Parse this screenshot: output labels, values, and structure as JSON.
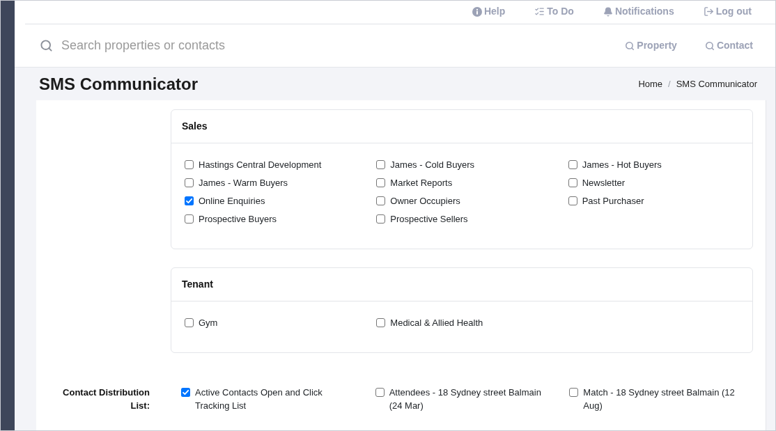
{
  "top_nav": [
    {
      "label": "Help"
    },
    {
      "label": "To Do"
    },
    {
      "label": "Notifications"
    },
    {
      "label": "Log out"
    }
  ],
  "search": {
    "placeholder": "Search properties or contacts"
  },
  "search_links": [
    {
      "label": "Property"
    },
    {
      "label": "Contact"
    }
  ],
  "page_header": {
    "title": "SMS Communicator",
    "breadcrumb": {
      "items": [
        {
          "label": "Home"
        },
        {
          "label": "SMS Communicator"
        }
      ],
      "separator": "/"
    }
  },
  "groups": [
    {
      "title": "Sales",
      "options": [
        {
          "label": "Hastings Central Development",
          "checked": false
        },
        {
          "label": "James - Cold Buyers",
          "checked": false
        },
        {
          "label": "James - Hot Buyers",
          "checked": false
        },
        {
          "label": "James - Warm Buyers",
          "checked": false
        },
        {
          "label": "Market Reports",
          "checked": false
        },
        {
          "label": "Newsletter",
          "checked": false
        },
        {
          "label": "Online Enquiries",
          "checked": true
        },
        {
          "label": "Owner Occupiers",
          "checked": false
        },
        {
          "label": "Past Purchaser",
          "checked": false
        },
        {
          "label": "Prospective Buyers",
          "checked": false
        },
        {
          "label": "Prospective Sellers",
          "checked": false
        }
      ]
    },
    {
      "title": "Tenant",
      "options": [
        {
          "label": "Gym",
          "checked": false
        },
        {
          "label": "Medical & Allied Health",
          "checked": false
        }
      ]
    }
  ],
  "distribution_list": {
    "label": "Contact Distribution List:",
    "options": [
      {
        "label": "Active Contacts Open and Click Tracking List",
        "checked": true
      },
      {
        "label": "Attendees - 18 Sydney street Balmain (24 Mar)",
        "checked": false
      },
      {
        "label": "Match - 18 Sydney street Balmain (12 Aug)",
        "checked": false
      }
    ]
  }
}
